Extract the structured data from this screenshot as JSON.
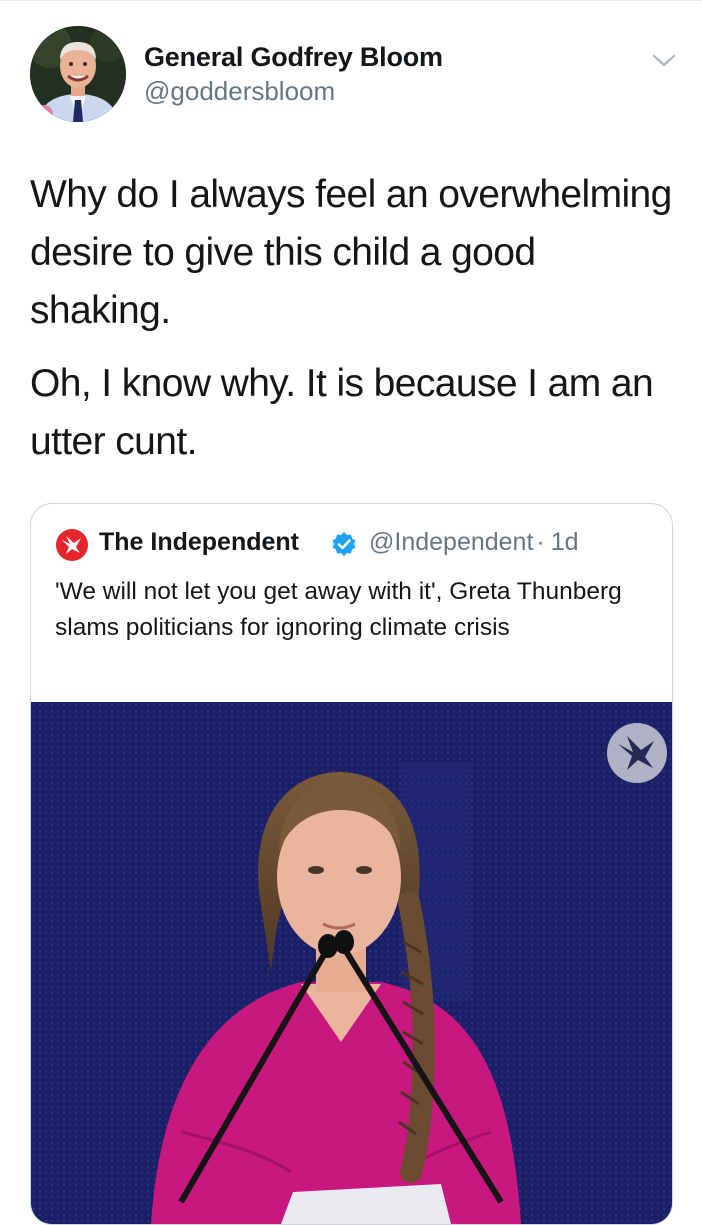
{
  "author": {
    "display_name": "General Godfrey Bloom",
    "handle": "@goddersbloom"
  },
  "tweet": {
    "paragraphs": [
      "Why do I always feel an overwhelming desire to give this child a good shaking.",
      "Oh, I know why. It is because I am an utter cunt."
    ]
  },
  "quoted_tweet": {
    "name": "The Independent",
    "handle": "@Independent",
    "separator": "·",
    "age": "1d",
    "text": "'We will not let you get away with it', Greta Thunberg slams politicians for ignoring climate crisis",
    "verified": true
  },
  "icons": {
    "menu": "chevron-down-icon",
    "verified": "verified-badge-icon",
    "logo": "independent-eagle-logo",
    "watermark": "independent-eagle-watermark"
  },
  "colors": {
    "primary_text": "#14171a",
    "secondary_text": "#657786",
    "verified_blue": "#1da1f2",
    "brand_red": "#e4262c",
    "media_background": "#1b1f66",
    "dress_magenta": "#c8177e"
  }
}
